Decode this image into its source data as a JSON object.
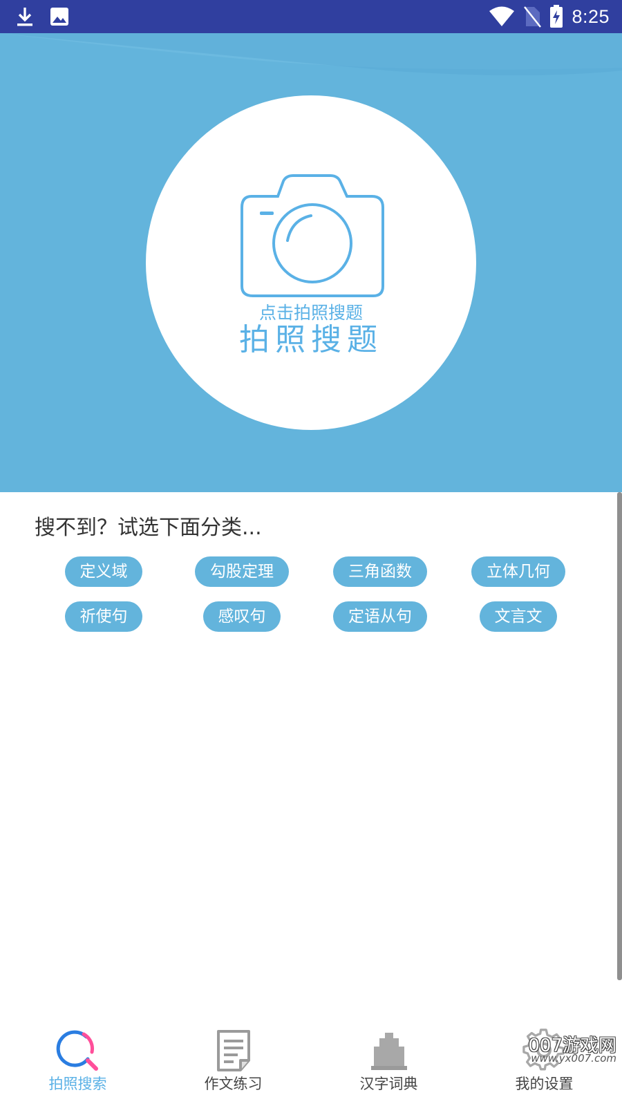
{
  "status_bar": {
    "time": "8:25",
    "icons": [
      "download-icon",
      "image-icon",
      "wifi-icon",
      "no-sim-icon",
      "battery-charging-icon"
    ]
  },
  "hero": {
    "hint": "点击拍照搜题",
    "title": "拍照搜题",
    "icon": "camera-icon",
    "colors": {
      "background": "#63b4dc",
      "accent": "#5ab1e6"
    }
  },
  "categories": {
    "heading": "搜不到？试选下面分类...",
    "items": [
      "定义域",
      "勾股定理",
      "三角函数",
      "立体几何",
      "祈使句",
      "感叹句",
      "定语从句",
      "文言文"
    ]
  },
  "bottom_nav": {
    "items": [
      {
        "label": "拍照搜索",
        "icon": "search-icon",
        "active": true
      },
      {
        "label": "作文练习",
        "icon": "document-icon",
        "active": false
      },
      {
        "label": "汉字词典",
        "icon": "dictionary-icon",
        "active": false
      },
      {
        "label": "我的设置",
        "icon": "gear-icon",
        "active": false
      }
    ]
  },
  "watermark": {
    "line1": "007游戏网",
    "line2": "www.yx007.com"
  }
}
